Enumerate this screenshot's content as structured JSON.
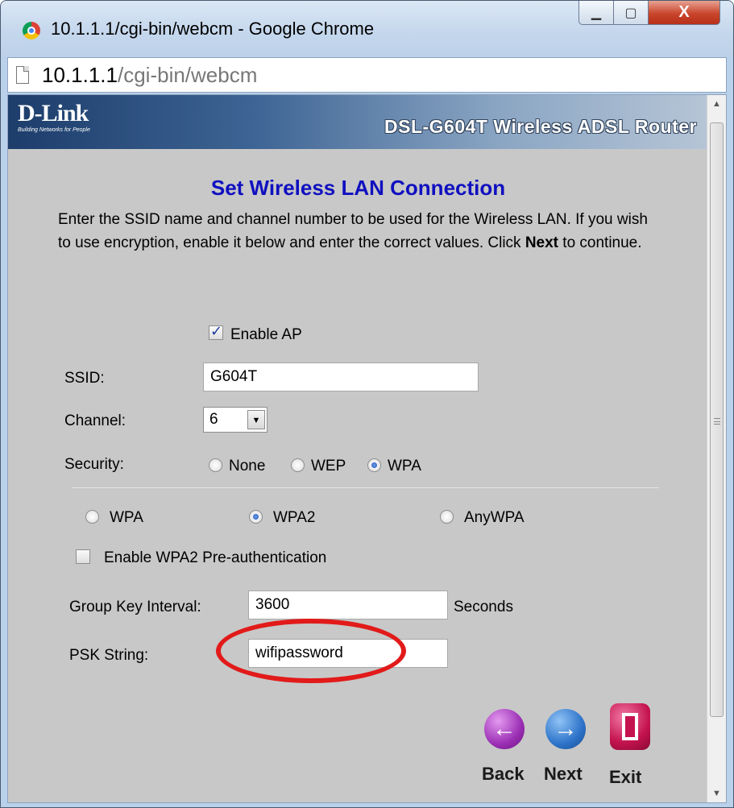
{
  "window": {
    "title": "10.1.1.1/cgi-bin/webcm - Google Chrome",
    "controls": {
      "minimize": "▁",
      "maximize": "▢",
      "close": "X"
    }
  },
  "addressbar": {
    "host": "10.1.1.1",
    "path": "/cgi-bin/webcm"
  },
  "router": {
    "brand": "D-Link",
    "tagline": "Building Networks for People",
    "model_title": "DSL-G604T Wireless ADSL Router"
  },
  "page": {
    "title": "Set Wireless LAN Connection",
    "instructions_prefix": "Enter the SSID name and channel number to be used for the Wireless LAN. If you wish to use encryption, enable it below and enter the correct values. Click ",
    "instructions_bold": "Next",
    "instructions_suffix": " to continue."
  },
  "form": {
    "enable_ap": {
      "label": "Enable AP",
      "checked": true
    },
    "ssid": {
      "label": "SSID:",
      "value": "G604T"
    },
    "channel": {
      "label": "Channel:",
      "value": "6"
    },
    "security": {
      "label": "Security:",
      "options": [
        "None",
        "WEP",
        "WPA"
      ],
      "selected": "WPA"
    },
    "wpa_mode": {
      "options": [
        "WPA",
        "WPA2",
        "AnyWPA"
      ],
      "selected": "WPA2"
    },
    "preauth": {
      "label": "Enable WPA2 Pre-authentication",
      "checked": false
    },
    "group_key_interval": {
      "label": "Group Key Interval:",
      "value": "3600",
      "unit": "Seconds"
    },
    "psk_string": {
      "label": "PSK String:",
      "value": "wifipassword"
    }
  },
  "nav": {
    "back": "Back",
    "next": "Next",
    "exit": "Exit"
  },
  "colors": {
    "title_blue": "#1010c0",
    "highlight_red": "#e21a1a",
    "page_bg": "#c8c8c8"
  }
}
